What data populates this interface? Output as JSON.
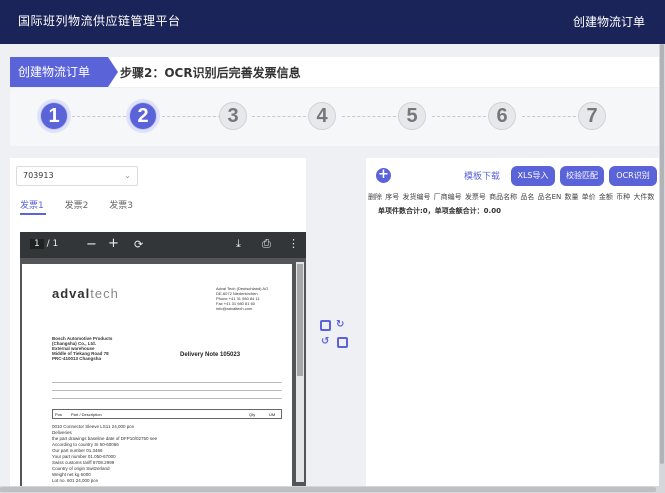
{
  "header": {
    "title": "国际班列物流供应链管理平台",
    "right_link": "创建物流订单"
  },
  "stepbar": {
    "badge": "创建物流订单",
    "step_text": "步骤2：OCR识别后完善发票信息"
  },
  "steps": [
    {
      "label": "1",
      "active": true
    },
    {
      "label": "2",
      "active": true
    },
    {
      "label": "3",
      "active": false
    },
    {
      "label": "4",
      "active": false
    },
    {
      "label": "5",
      "active": false
    },
    {
      "label": "6",
      "active": false
    },
    {
      "label": "7",
      "active": false
    }
  ],
  "left": {
    "select_value": "703913",
    "tabs": [
      "发票1",
      "发票2",
      "发票3"
    ],
    "pdf": {
      "page_current": "1",
      "page_total": "/ 1",
      "doc": {
        "logo_main": "adval",
        "logo_sub": "tech",
        "note": "Delivery Note  105023",
        "addr_left": [
          "Bosch Automotive Products",
          "(Changsha) Co., Ltd.",
          "External warehouse",
          "Middle of Tiekang Road 78",
          "PRC-410013 Changsha"
        ],
        "addr_right": [
          "Adval Tech (Deutschland) AG",
          "DE-6072 Niederkirchen",
          "Phone +41 31 980 84 11",
          "Fax +41 31 980 81 60",
          "info@advaltech.com"
        ],
        "table_headers": [
          "Pos",
          "Part / Description",
          "Qty",
          "UM"
        ],
        "row_text": [
          "0010  Connector Sleeve LS11                 24,000  pce",
          "Deliveries",
          "the part drawings baseline date of DFP10/02750 see",
          "According to country     SI 50-60066",
          "Our part number          01.3466",
          "Your part number         01.050-67000",
          "Swiss customs tariff     8708.2999",
          "Country of origin        Switzerland",
          "Weight net               kg 6000",
          "Lot no.                  601           24,000 pce"
        ]
      }
    }
  },
  "right": {
    "template_link": "模板下载",
    "buttons": [
      "XLS导入",
      "校验匹配",
      "OCR识别"
    ],
    "columns_text": "删除 序号 发货编号 厂商编号 发票号 商品名称 品名 品名EN 数量 单价 金额 币种 大件数",
    "summary": "单项件数合计:0，单项金额合计：0.00"
  },
  "colors": {
    "header_bg": "#1b2458",
    "accent": "#5b63d8"
  }
}
